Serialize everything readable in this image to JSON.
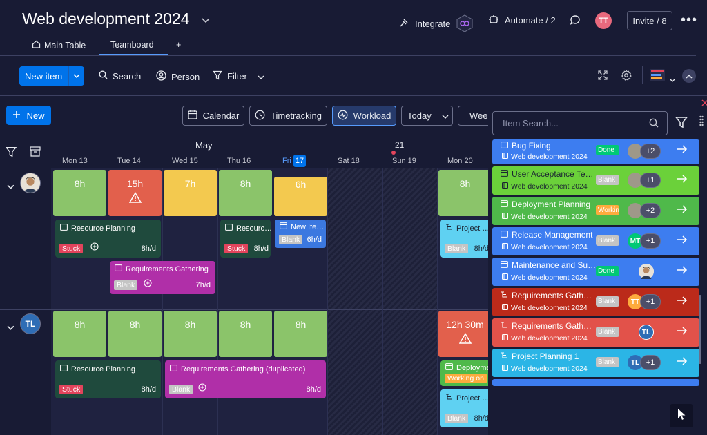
{
  "header": {
    "title": "Web development 2024",
    "integrate": "Integrate",
    "automate": "Automate / 2",
    "user_initials": "TT",
    "invite": "Invite / 8",
    "more": "•••"
  },
  "tabs": [
    {
      "label": "Main Table"
    },
    {
      "label": "Teamboard"
    },
    {
      "label": "+"
    }
  ],
  "toolbar": {
    "new_item": "New item",
    "search": "Search",
    "person": "Person",
    "filter": "Filter"
  },
  "view_toolbar": {
    "new": "New",
    "calendar": "Calendar",
    "timetracking": "Timetracking",
    "workload": "Workload",
    "today": "Today",
    "week": "Week"
  },
  "calendar": {
    "month": "May",
    "next_week_num": "21",
    "days": [
      {
        "label": "Mon 13"
      },
      {
        "label": "Tue 14"
      },
      {
        "label": "Wed 15"
      },
      {
        "label": "Thu 16"
      },
      {
        "label": "Fri",
        "num": "17"
      },
      {
        "label": "Sat 18"
      },
      {
        "label": "Sun 19"
      },
      {
        "label": "Mon 20"
      }
    ],
    "rows": [
      {
        "avatar": "",
        "capacity": [
          "8h",
          "15h",
          "7h",
          "8h",
          "6h",
          "8h"
        ],
        "cards": [
          {
            "title": "Resource Planning",
            "status": "Stuck",
            "hours": "8h/d"
          },
          {
            "title": "Resourc…",
            "status": "Stuck",
            "hours": "8h/d"
          },
          {
            "title": "New Ite…",
            "status": "Blank",
            "hours": "6h/d"
          },
          {
            "title": "Project …",
            "status": "Blank",
            "hours": "8h/d"
          },
          {
            "title": "Requirements Gathering",
            "status": "Blank",
            "hours": "7h/d"
          }
        ]
      },
      {
        "avatar": "TL",
        "capacity": [
          "8h",
          "8h",
          "8h",
          "8h",
          "8h",
          "12h 30m"
        ],
        "cards": [
          {
            "title": "Resource Planning",
            "status": "Stuck",
            "hours": "8h/d"
          },
          {
            "title": "Requirements Gathering (duplicated)",
            "status": "Blank",
            "hours": "8h/d"
          },
          {
            "title": "Deployme…",
            "status": "Working on"
          },
          {
            "title": "Project …",
            "status": "Blank",
            "hours": "8h/d"
          }
        ]
      }
    ]
  },
  "panel": {
    "search_placeholder": "Item Search...",
    "items": [
      {
        "title": "Bug Fixing",
        "board": "Web development 2024",
        "status": "Done",
        "extra": "+2",
        "color": "#3d7df0",
        "status_color": "#00c875"
      },
      {
        "title": "User Acceptance Te…",
        "board": "Web development 2024",
        "status": "Blank",
        "extra": "+1",
        "color": "#6bd13a",
        "status_color": "#c4c4c4"
      },
      {
        "title": "Deployment Planning",
        "board": "Web development 2024",
        "status": "Working on it",
        "extra": "+2",
        "color": "#4fb94a",
        "status_color": "#fdab3d"
      },
      {
        "title": "Release Management",
        "board": "Web development 2024",
        "status": "Blank",
        "extra": "+1",
        "avatar": "MT",
        "color": "#3d7df0",
        "status_color": "#c4c4c4"
      },
      {
        "title": "Maintenance and Su…",
        "board": "Web development 2024",
        "status": "Done",
        "color": "#3d7df0",
        "status_color": "#00c875"
      },
      {
        "title": "Requirements Gath…",
        "board": "Web development 2024",
        "status": "Blank",
        "extra": "+1",
        "avatar": "TT",
        "color": "#bb2a1a",
        "status_color": "#c4c4c4"
      },
      {
        "title": "Requirements Gath…",
        "board": "Web development 2024",
        "status": "Blank",
        "avatar": "TL",
        "color": "#e2524a",
        "status_color": "#c4c4c4"
      },
      {
        "title": "Project Planning 1",
        "board": "Web development 2024",
        "status": "Blank",
        "extra": "+1",
        "avatar": "TL",
        "color": "#2bb5e6",
        "status_color": "#c4c4c4"
      }
    ]
  },
  "colors": {
    "accent": "#0073ea",
    "stuck": "#e2445c",
    "blank_badge": "#c4c4c4",
    "done": "#00c875",
    "working": "#fdab3d",
    "cap_green": "#8bc46a",
    "cap_red": "#e2604c",
    "cap_yellow": "#f3c94f",
    "card_dark": "#1f4a3d",
    "card_magenta": "#b02fa8",
    "card_blue": "#3b78e0",
    "card_cyan": "#5fd1f2"
  }
}
